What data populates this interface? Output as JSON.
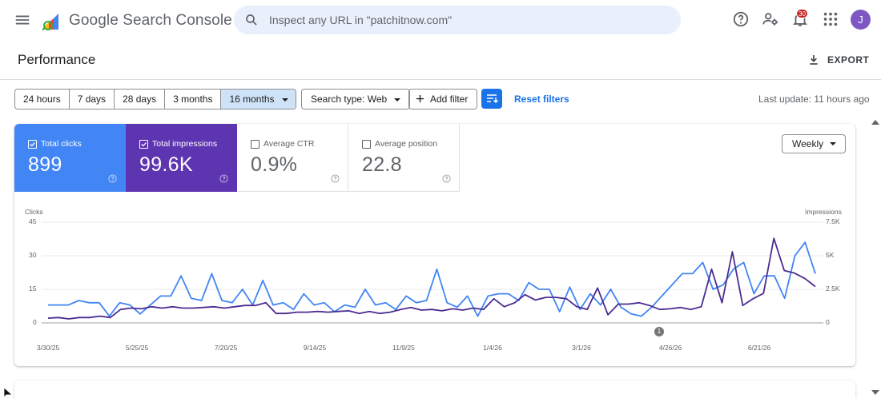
{
  "app": {
    "title": "Google Search Console"
  },
  "search": {
    "placeholder": "Inspect any URL in \"patchitnow.com\""
  },
  "topbar": {
    "notification_count": "30",
    "avatar_initial": "J",
    "icons": [
      "menu-icon",
      "help-icon",
      "manage-users-icon",
      "bell-icon",
      "apps-icon"
    ]
  },
  "page": {
    "title": "Performance",
    "export_label": "EXPORT"
  },
  "filters": {
    "ranges": [
      "24 hours",
      "7 days",
      "28 days",
      "3 months",
      "16 months"
    ],
    "active_range": "16 months",
    "search_type": "Search type: Web",
    "add_filter": "Add filter",
    "reset": "Reset filters",
    "last_update": "Last update: 11 hours ago"
  },
  "metrics": [
    {
      "label": "Total clicks",
      "value": "899",
      "checked": true,
      "color": "#4285f4"
    },
    {
      "label": "Total impressions",
      "value": "99.6K",
      "checked": true,
      "color": "#5e35b1"
    },
    {
      "label": "Average CTR",
      "value": "0.9%",
      "checked": false,
      "color": "#ffffff"
    },
    {
      "label": "Average position",
      "value": "22.8",
      "checked": false,
      "color": "#ffffff"
    }
  ],
  "granularity": "Weekly",
  "chart_data": {
    "type": "line",
    "y_left_label": "Clicks",
    "y_right_label": "Impressions",
    "y_left_ticks": [
      "45",
      "30",
      "15",
      "0"
    ],
    "y_right_ticks": [
      "7.5K",
      "5K",
      "2.5K",
      "0"
    ],
    "ylim_left": [
      0,
      45
    ],
    "ylim_right": [
      0,
      7500
    ],
    "x_ticks": [
      "3/30/25",
      "5/25/25",
      "7/20/25",
      "9/14/25",
      "11/9/25",
      "1/4/26",
      "3/1/26",
      "4/26/26",
      "6/21/26"
    ],
    "annotation": "1",
    "series": [
      {
        "name": "Clicks",
        "color": "#4285f4",
        "axis": "left",
        "values": [
          8,
          8,
          8,
          10,
          9,
          9,
          3,
          9,
          8,
          4,
          8,
          12,
          12,
          21,
          11,
          10,
          22,
          10,
          9,
          15,
          8,
          19,
          8,
          9,
          6,
          13,
          8,
          9,
          5,
          8,
          7,
          15,
          8,
          9,
          6,
          12,
          9,
          10,
          24,
          9,
          7,
          12,
          3,
          12,
          13,
          13,
          10,
          18,
          15,
          15,
          5,
          16,
          6,
          13,
          8,
          15,
          7,
          4,
          3,
          7,
          12,
          17,
          22,
          22,
          27,
          15,
          17,
          24,
          27,
          13,
          21,
          21,
          11,
          30,
          36,
          22
        ]
      },
      {
        "name": "Impressions",
        "color": "#4b2c91",
        "axis": "right",
        "values": [
          350,
          400,
          300,
          400,
          400,
          500,
          400,
          1000,
          1100,
          1050,
          1200,
          1100,
          1200,
          1100,
          1100,
          1150,
          1200,
          1100,
          1200,
          1300,
          1300,
          1500,
          700,
          700,
          800,
          800,
          850,
          800,
          850,
          900,
          700,
          850,
          700,
          800,
          1000,
          1150,
          950,
          1000,
          900,
          1050,
          950,
          1100,
          1000,
          1800,
          1200,
          1500,
          2100,
          1700,
          1900,
          1900,
          1800,
          1200,
          1000,
          2600,
          600,
          1400,
          1400,
          1500,
          1300,
          1000,
          1050,
          1150,
          1000,
          1200,
          4000,
          1500,
          5300,
          1300,
          1800,
          2200,
          6300,
          3900,
          3700,
          3300,
          2700
        ]
      }
    ]
  }
}
